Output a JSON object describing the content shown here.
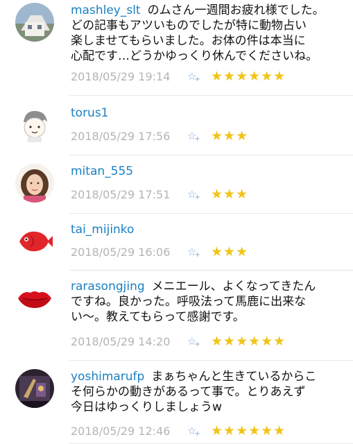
{
  "comments": [
    {
      "username": "mashley_slt",
      "lines": [
        "のムさん一週間お疲れ様でした。",
        "どの記事もアツいものでしたが特に動物占い",
        "楽しませてもらいました。お体の件は本当に",
        "心配です…どうかゆっくり休んでくださいね。"
      ],
      "timestamp": "2018/05/29 19:14",
      "add_star_icon": "add-star-icon",
      "stars": "★★★★★★",
      "star_count": 6
    },
    {
      "username": "torus1",
      "lines": [],
      "timestamp": "2018/05/29 17:56",
      "add_star_icon": "add-star-icon",
      "stars": "★★★",
      "star_count": 3
    },
    {
      "username": "mitan_555",
      "lines": [],
      "timestamp": "2018/05/29 17:51",
      "add_star_icon": "add-star-icon",
      "stars": "★★★",
      "star_count": 3
    },
    {
      "username": "tai_mijinko",
      "lines": [],
      "timestamp": "2018/05/29 16:06",
      "add_star_icon": "add-star-icon",
      "stars": "★★★",
      "star_count": 3
    },
    {
      "username": "rarasongjing",
      "lines": [
        "メニエール、よくなってきたん",
        "ですね。良かった。呼吸法って馬鹿に出来な",
        "い〜。教えてもらって感謝です。"
      ],
      "timestamp": "2018/05/29 14:20",
      "add_star_icon": "add-star-icon",
      "stars": "★★★★★★",
      "star_count": 6
    },
    {
      "username": "yoshimarufp",
      "lines": [
        "まぁちゃんと生きているからこ",
        "そ何らかの動きがあるって事で。とりあえず",
        "今日はゆっくりしましょうw"
      ],
      "timestamp": "2018/05/29 12:46",
      "add_star_icon": "add-star-icon",
      "stars": "★★★★★★",
      "star_count": 6
    }
  ],
  "colors": {
    "username": "#1a7fc1",
    "timestamp": "#b4b4b4",
    "star": "#f0c419",
    "add_star": "#7da7d8"
  }
}
